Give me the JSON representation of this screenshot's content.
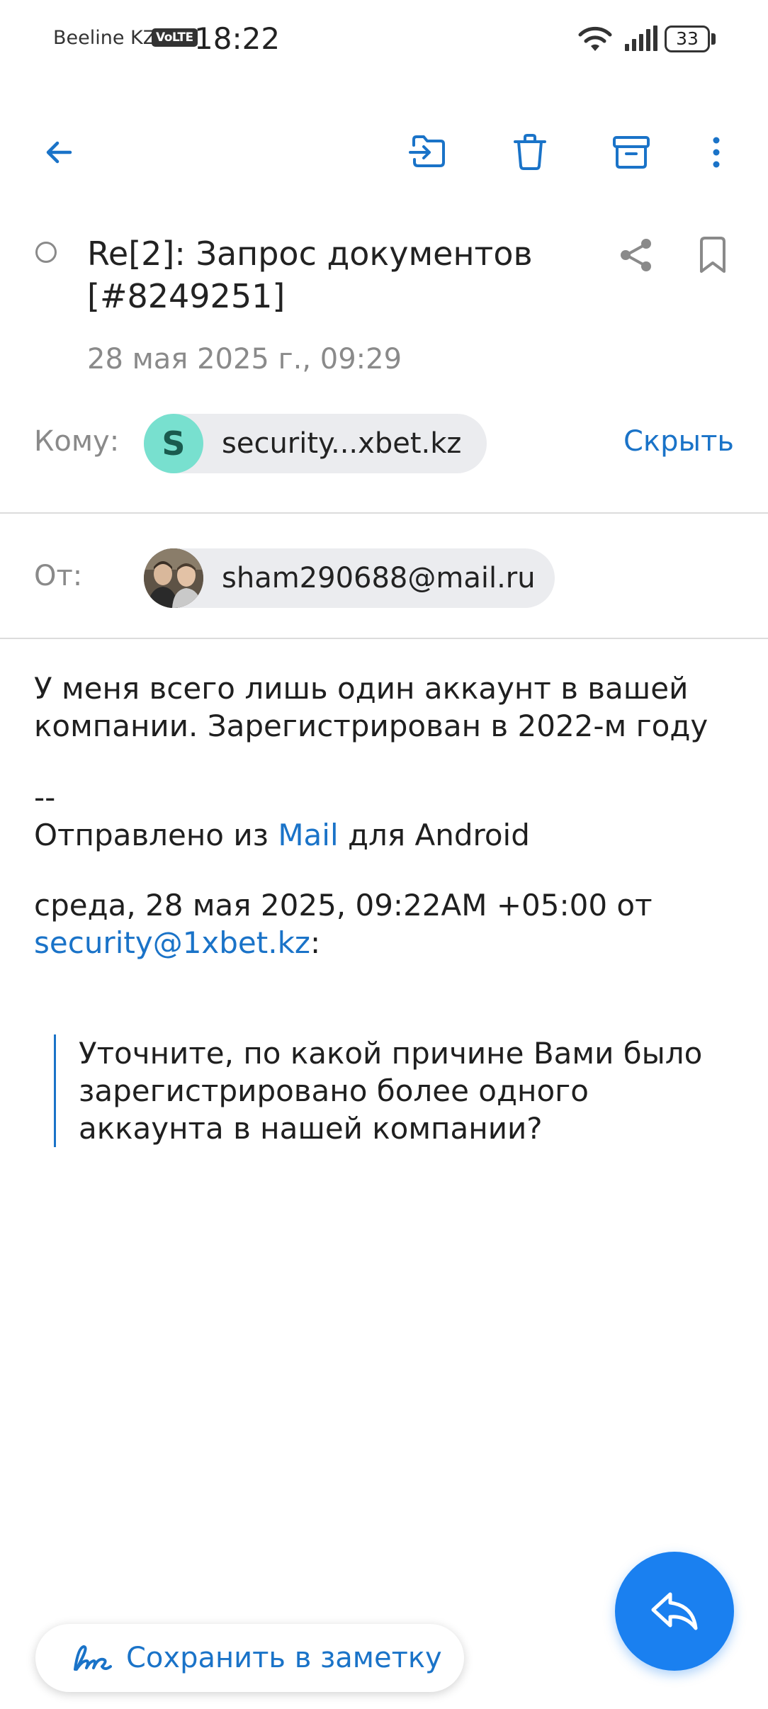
{
  "status_bar": {
    "carrier": "Beeline KZ",
    "volte": "VoLTE",
    "time": "18:22",
    "battery": "33"
  },
  "toolbar": {
    "icons": [
      "back-arrow-icon",
      "move-to-folder-icon",
      "trash-icon",
      "archive-icon",
      "more-vert-icon"
    ]
  },
  "message": {
    "subject": "Re[2]: Запрос документов [#8249251]",
    "date": "28 мая 2025 г., 09:29",
    "to_label": "Кому:",
    "to_avatar_letter": "S",
    "to_address": "security...xbet.kz",
    "hide_label": "Скрыть",
    "from_label": "От:",
    "from_address": "sham290688@mail.ru"
  },
  "body": {
    "line1": "У меня всего лишь один аккаунт в вашей компании. Зарегистрирован в 2022-м году",
    "signature_sep": "--",
    "sent_from_prefix": "Отправлено из ",
    "sent_from_link": "Mail",
    "sent_from_suffix": " для Android",
    "reply_header": "среда, 28 мая 2025, 09:22AM +05:00 от",
    "reply_header_link": "security@1xbet.kz",
    "reply_header_suffix": ":",
    "quote": "Уточните, по какой причине Вами было зарегистрировано более одного аккаунта в нашей компании?"
  },
  "actions": {
    "save_note_label": "Сохранить в заметку"
  },
  "colors": {
    "accent": "#1a73c8",
    "fab": "#1a80f0",
    "avatar_s": "#78e0cf"
  }
}
